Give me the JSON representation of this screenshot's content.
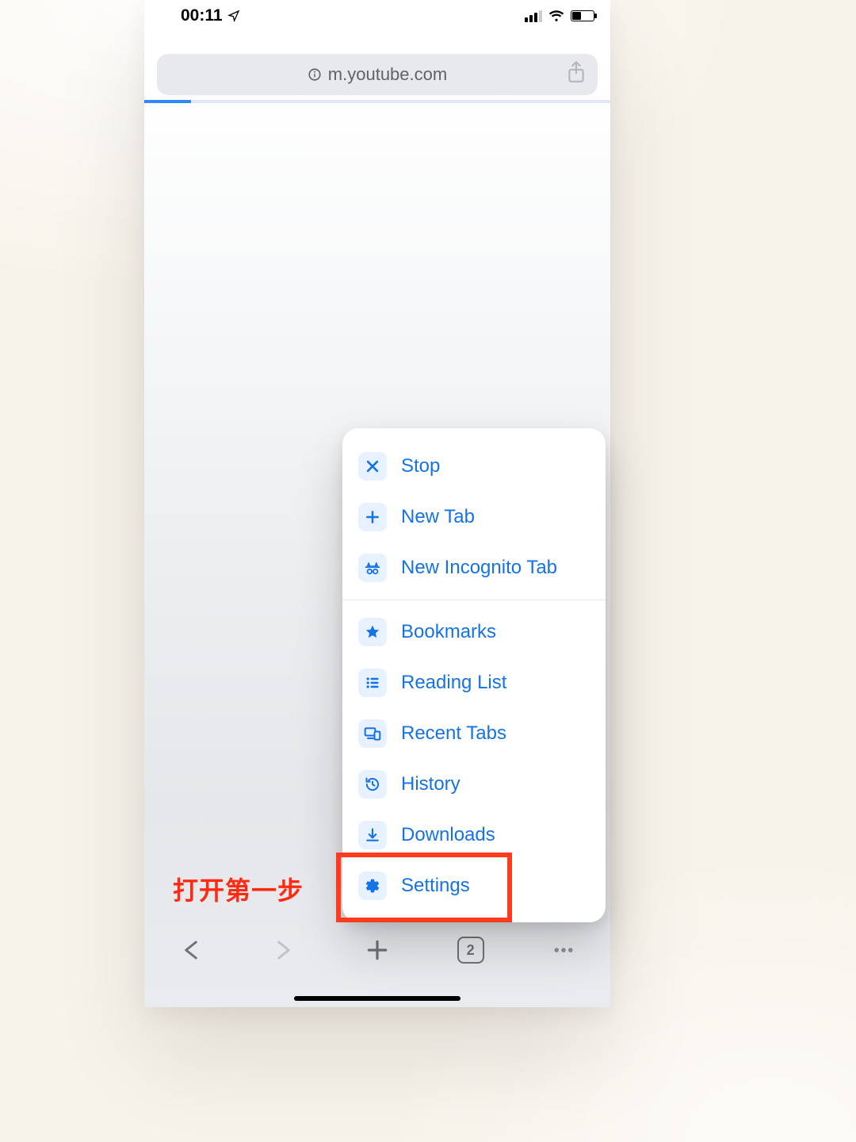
{
  "status": {
    "time": "00:11"
  },
  "url_bar": {
    "text": "m.youtube.com"
  },
  "progress": {
    "percent": 10
  },
  "toolbar": {
    "tab_count": "2"
  },
  "menu": {
    "items": [
      {
        "key": "stop",
        "label": "Stop",
        "icon": "x-icon"
      },
      {
        "key": "new_tab",
        "label": "New Tab",
        "icon": "plus-icon"
      },
      {
        "key": "incognito",
        "label": "New Incognito Tab",
        "icon": "incognito-icon"
      },
      {
        "key": "_sep"
      },
      {
        "key": "bookmarks",
        "label": "Bookmarks",
        "icon": "star-icon"
      },
      {
        "key": "reading_list",
        "label": "Reading List",
        "icon": "list-icon"
      },
      {
        "key": "recent_tabs",
        "label": "Recent Tabs",
        "icon": "devices-icon"
      },
      {
        "key": "history",
        "label": "History",
        "icon": "history-icon"
      },
      {
        "key": "downloads",
        "label": "Downloads",
        "icon": "download-icon"
      },
      {
        "key": "settings",
        "label": "Settings",
        "icon": "gear-icon",
        "highlighted": true
      }
    ]
  },
  "annotation": {
    "text": "打开第一步"
  },
  "colors": {
    "accent_blue": "#1473e6",
    "highlight_red": "#ff3b1f"
  }
}
